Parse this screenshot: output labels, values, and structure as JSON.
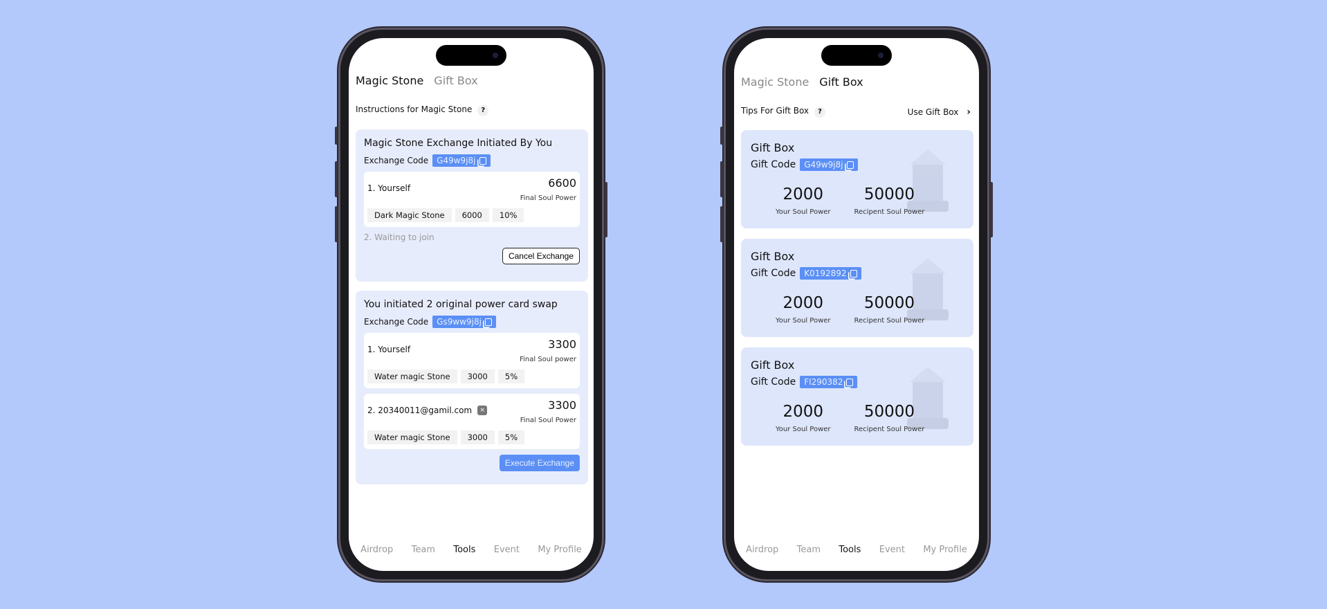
{
  "left_screen": {
    "tabs": [
      {
        "label": "Magic Stone",
        "active": true
      },
      {
        "label": "Gift Box",
        "active": false
      }
    ],
    "instructions": "Instructions for Magic Stone",
    "help_icon": "?",
    "card1": {
      "title": "Magic Stone Exchange Initiated By You",
      "code_label": "Exchange Code",
      "code": "G49w9j8j",
      "party1": {
        "name": "1. Yourself",
        "value": "6600",
        "value_label": "Final Soul Power",
        "stone": "Dark Magic Stone",
        "amount": "6000",
        "percent": "10%"
      },
      "waiting": "2. Waiting to join",
      "cancel": "Cancel Exchange"
    },
    "card2": {
      "title": "You initiated 2 original power card swap",
      "code_label": "Exchange Code",
      "code": "Gs9ww9j8j",
      "party1": {
        "name": "1. Yourself",
        "value": "3300",
        "value_label": "Final Soul power",
        "stone": "Water magic Stone",
        "amount": "3000",
        "percent": "5%"
      },
      "party2": {
        "name": "2. 20340011@gamil.com",
        "value": "3300",
        "value_label": "Final Soul Power",
        "stone": "Water magic Stone",
        "amount": "3000",
        "percent": "5%",
        "remove_icon": "×"
      },
      "execute": "Execute Exchange"
    }
  },
  "right_screen": {
    "tabs": [
      {
        "label": "Magic Stone",
        "active": false
      },
      {
        "label": "Gift Box",
        "active": true
      }
    ],
    "tips": "Tips For Gift Box",
    "help_icon": "?",
    "use_gift_box": "Use Gift Box",
    "chevron": "›",
    "boxes": [
      {
        "title": "Gift Box",
        "code_label": "Gift Code",
        "code": "G49w9j8j",
        "your": "2000",
        "your_label": "Your Soul Power",
        "recipient": "50000",
        "recipient_label": "Recipent Soul Power"
      },
      {
        "title": "Gift Box",
        "code_label": "Gift Code",
        "code": "K0192892",
        "your": "2000",
        "your_label": "Your Soul Power",
        "recipient": "50000",
        "recipient_label": "Recipent Soul Power"
      },
      {
        "title": "Gift Box",
        "code_label": "Gift Code",
        "code": "FI290382",
        "your": "2000",
        "your_label": "Your Soul Power",
        "recipient": "50000",
        "recipient_label": "Recipent Soul Power"
      }
    ]
  },
  "nav": [
    {
      "label": "Airdrop"
    },
    {
      "label": "Team"
    },
    {
      "label": "Tools",
      "active": true
    },
    {
      "label": "Event"
    },
    {
      "label": "My Profile"
    }
  ],
  "colors": {
    "background": "#b3c8fb",
    "accent": "#5b8ff5",
    "card": "#e7ecfc"
  }
}
